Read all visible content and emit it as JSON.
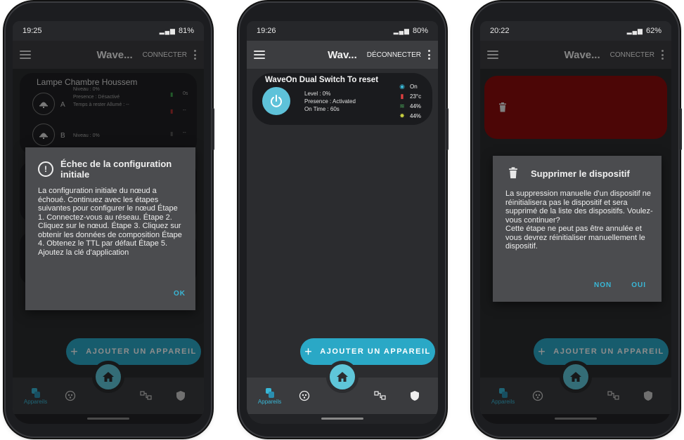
{
  "phones": [
    {
      "status_time": "19:25",
      "status_battery": "81%",
      "app_title": "Wave...",
      "connect_label": "CONNECTER",
      "device_name": "Lampe Chambre Houssem",
      "channel_a_letter": "A",
      "channel_a_info": [
        "Niveau : 0%",
        "Presence : Désactivé",
        "Temps à rester Allumé : --"
      ],
      "channel_a_status": "0s",
      "channel_b_letter": "B",
      "channel_b_info": "Niveau : 0%",
      "dialog_title": "Échec de la configuration initiale",
      "dialog_body": "La configuration initiale du nœud a échoué. Continuez avec les étapes suivantes pour configurer le nœud Étape 1. Connectez-vous au réseau. Étape 2. Cliquez sur le nœud. Étape 3. Cliquez sur obtenir les données de composition Étape 4. Obtenez le TTL par défaut Étape 5. Ajoutez la clé d'application",
      "dialog_ok": "OK",
      "fab_label": "AJOUTER UN APPAREIL",
      "nav_devices_label": "Appareils"
    },
    {
      "status_time": "19:26",
      "status_battery": "80%",
      "app_title": "Wav...",
      "connect_label": "DÉCONNECTER",
      "device_name": "WaveOn Dual Switch To reset",
      "level": "Level : 0%",
      "presence": "Presence : Activated",
      "on_time": "On Time : 60s",
      "stat_on": "On",
      "stat_temp": "23°c",
      "stat_humidity": "44%",
      "stat_light": "44%",
      "fab_label": "AJOUTER UN APPAREIL",
      "nav_devices_label": "Appareils"
    },
    {
      "status_time": "20:22",
      "status_battery": "62%",
      "app_title": "Wave...",
      "connect_label": "CONNECTER",
      "dialog_title": "Supprimer le dispositif",
      "dialog_body": "La suppression manuelle d'un dispositif ne réinitialisera pas le dispositif et sera supprimé de la liste des dispositifs. Voulez-vous continuer?\nCette étape ne peut pas être annulée et vous devrez réinitialiser manuellement le dispositif.",
      "dialog_no": "NON",
      "dialog_yes": "OUI",
      "fab_label": "AJOUTER UN APPAREIL",
      "nav_devices_label": "Appareils"
    }
  ],
  "colors": {
    "accent": "#39b7d6",
    "fab": "#2aa8c6",
    "danger_card": "#8a0c0c",
    "screen_bg": "#2b2c2f"
  }
}
